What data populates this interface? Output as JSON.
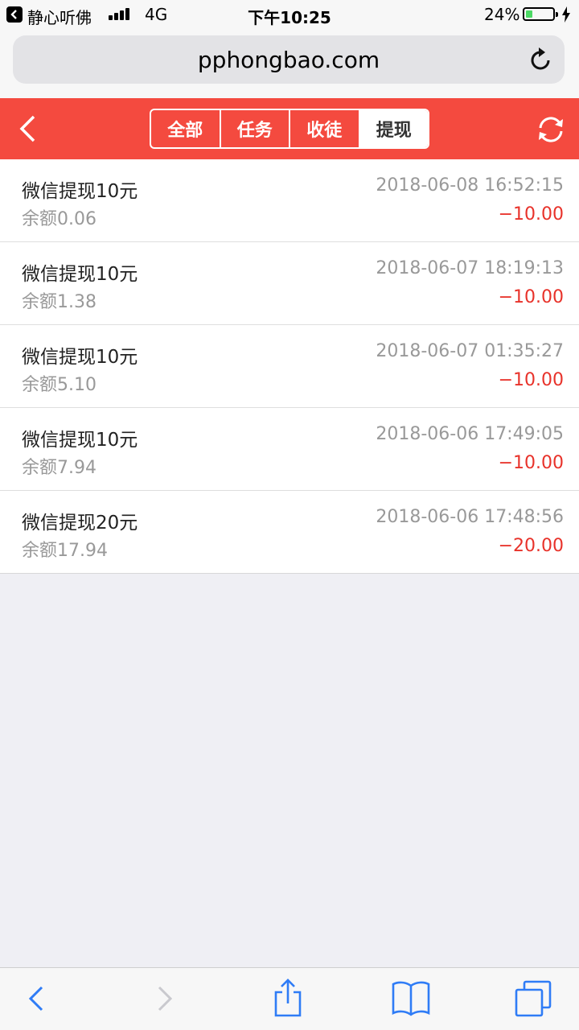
{
  "status_bar": {
    "app_name": "静心听佛",
    "network": "4G",
    "time": "下午10:25",
    "battery_percent": "24%",
    "battery_level": 0.24
  },
  "browser": {
    "url": "pphongbao.com"
  },
  "header": {
    "tabs": [
      {
        "label": "全部",
        "active": false
      },
      {
        "label": "任务",
        "active": false
      },
      {
        "label": "收徒",
        "active": false
      },
      {
        "label": "提现",
        "active": true
      }
    ]
  },
  "records": [
    {
      "title": "微信提现10元",
      "time": "2018-06-08 16:52:15",
      "balance": "余额0.06",
      "amount": "−10.00"
    },
    {
      "title": "微信提现10元",
      "time": "2018-06-07 18:19:13",
      "balance": "余额1.38",
      "amount": "−10.00"
    },
    {
      "title": "微信提现10元",
      "time": "2018-06-07 01:35:27",
      "balance": "余额5.10",
      "amount": "−10.00"
    },
    {
      "title": "微信提现10元",
      "time": "2018-06-06 17:49:05",
      "balance": "余额7.94",
      "amount": "−10.00"
    },
    {
      "title": "微信提现20元",
      "time": "2018-06-06 17:48:56",
      "balance": "余额17.94",
      "amount": "−20.00"
    }
  ],
  "colors": {
    "header_red": "#f44a3f",
    "amount_red": "#e8322a",
    "ios_blue": "#2f7cf6"
  },
  "icons": {
    "header_left": "chevron-left-icon",
    "header_right": "refresh-icon",
    "toolbar": [
      "back-arrow-icon",
      "forward-arrow-icon",
      "share-icon",
      "bookmarks-icon",
      "tabs-icon"
    ]
  }
}
